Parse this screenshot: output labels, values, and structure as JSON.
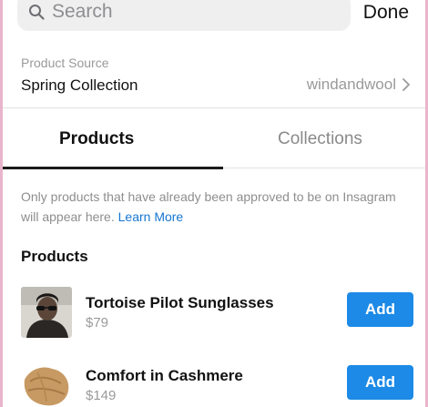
{
  "search": {
    "placeholder": "Search",
    "done_label": "Done"
  },
  "source": {
    "label": "Product Source",
    "value": "Spring Collection",
    "account": "windandwool"
  },
  "tabs": [
    {
      "label": "Products",
      "active": true
    },
    {
      "label": "Collections",
      "active": false
    }
  ],
  "notice": {
    "text": "Only products that have already been approved to be on Insagram will appear here. ",
    "link": "Learn More"
  },
  "section_title": "Products",
  "products": [
    {
      "name": "Tortoise Pilot Sunglasses",
      "price": "$79",
      "add_label": "Add",
      "thumb_icon": "sunglasses-model-photo"
    },
    {
      "name": "Comfort in Cashmere",
      "price": "$149",
      "add_label": "Add",
      "thumb_icon": "cashmere-sweater-photo"
    }
  ],
  "colors": {
    "accent": "#1c8ae6",
    "link": "#1677d2",
    "muted": "#9a9a9a",
    "border": "#e9b5cc"
  }
}
